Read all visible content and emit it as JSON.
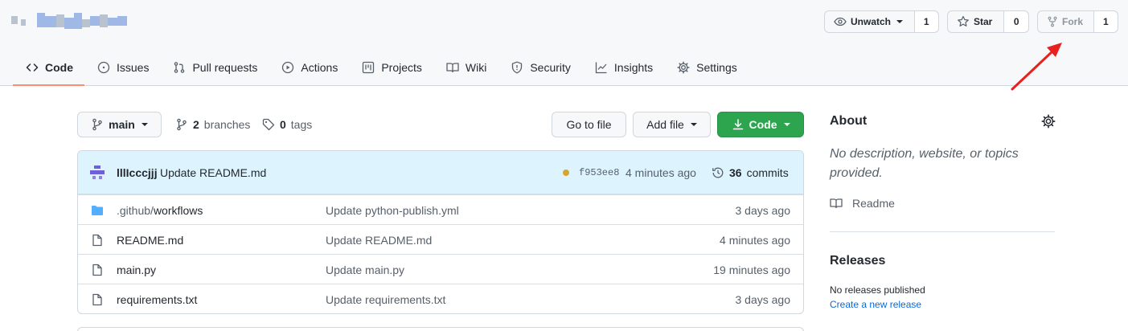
{
  "repo": {
    "title_obscured": ""
  },
  "actions": {
    "watch": {
      "label": "Unwatch",
      "count": "1"
    },
    "star": {
      "label": "Star",
      "count": "0"
    },
    "fork": {
      "label": "Fork",
      "count": "1"
    }
  },
  "tabs": [
    {
      "label": "Code",
      "icon": "code-icon",
      "selected": true
    },
    {
      "label": "Issues",
      "icon": "issue-icon"
    },
    {
      "label": "Pull requests",
      "icon": "pull-request-icon"
    },
    {
      "label": "Actions",
      "icon": "play-icon"
    },
    {
      "label": "Projects",
      "icon": "project-icon"
    },
    {
      "label": "Wiki",
      "icon": "book-icon"
    },
    {
      "label": "Security",
      "icon": "shield-icon"
    },
    {
      "label": "Insights",
      "icon": "graph-icon"
    },
    {
      "label": "Settings",
      "icon": "gear-icon"
    }
  ],
  "branch_bar": {
    "branch": "main",
    "branches_count": "2",
    "branches_label": "branches",
    "tags_count": "0",
    "tags_label": "tags",
    "go_to_file": "Go to file",
    "add_file": "Add file",
    "code": "Code"
  },
  "latest_commit": {
    "author": "lllIcccjjj",
    "message": "Update README.md",
    "sha": "f953ee8",
    "time": "4 minutes ago",
    "commits_count": "36",
    "commits_label": "commits",
    "status_color": "#d4a72c"
  },
  "files": [
    {
      "type": "folder",
      "name_prefix": ".github/",
      "name": "workflows",
      "message": "Update python-publish.yml",
      "age": "3 days ago"
    },
    {
      "type": "file",
      "name_prefix": "",
      "name": "README.md",
      "message": "Update README.md",
      "age": "4 minutes ago"
    },
    {
      "type": "file",
      "name_prefix": "",
      "name": "main.py",
      "message": "Update main.py",
      "age": "19 minutes ago"
    },
    {
      "type": "file",
      "name_prefix": "",
      "name": "requirements.txt",
      "message": "Update requirements.txt",
      "age": "3 days ago"
    }
  ],
  "about": {
    "title": "About",
    "description": "No description, website, or topics provided.",
    "readme": "Readme"
  },
  "releases": {
    "title": "Releases",
    "none": "No releases published",
    "create": "Create a new release"
  },
  "colors": {
    "accent_tab": "#fd8c73",
    "primary_green": "#2da44e",
    "link_blue": "#0969da",
    "annotation_arrow": "#e8211f"
  }
}
